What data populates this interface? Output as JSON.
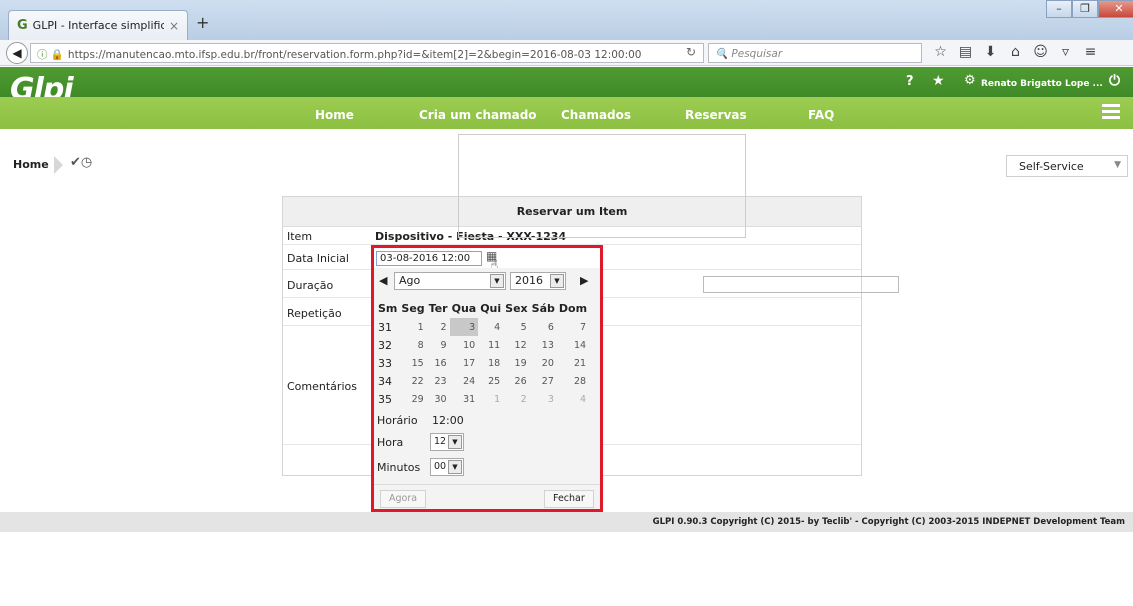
{
  "browser": {
    "tab_title": "GLPI - Interface simplificada",
    "tab_close": "×",
    "new_tab": "+",
    "url": "https://manutencao.mto.ifsp.edu.br/front/reservation.form.php?id=&item[2]=2&begin=2016-08-03 12:00:00",
    "search_placeholder": "Pesquisar"
  },
  "header": {
    "logo": "Glpi",
    "help": "?",
    "user": "Renato Brigatto Lope ...",
    "menu": [
      "Home",
      "Cria um chamado",
      "Chamados",
      "Reservas",
      "FAQ"
    ]
  },
  "breadcrumb": {
    "home": "Home"
  },
  "profile_select": "Self-Service",
  "form": {
    "title": "Reservar um Item",
    "labels": {
      "item": "Item",
      "start": "Data Inicial",
      "duration": "Duração",
      "repeat": "Repetição",
      "comments": "Comentários"
    },
    "item_value": "Dispositivo - Fiesta - XXX-1234",
    "start_value": "03-08-2016 12:00"
  },
  "datepicker": {
    "month": "Ago",
    "year": "2016",
    "headers": [
      "Sm",
      "Seg",
      "Ter",
      "Qua",
      "Qui",
      "Sex",
      "Sáb",
      "Dom"
    ],
    "weeks": [
      [
        "31",
        "1",
        "2",
        "3",
        "4",
        "5",
        "6",
        "7"
      ],
      [
        "32",
        "8",
        "9",
        "10",
        "11",
        "12",
        "13",
        "14"
      ],
      [
        "33",
        "15",
        "16",
        "17",
        "18",
        "19",
        "20",
        "21"
      ],
      [
        "34",
        "22",
        "23",
        "24",
        "25",
        "26",
        "27",
        "28"
      ],
      [
        "35",
        "29",
        "30",
        "31",
        "1",
        "2",
        "3",
        "4"
      ]
    ],
    "time_label": "Horário",
    "time_value": "12:00",
    "hour_label": "Hora",
    "hour_value": "12",
    "minute_label": "Minutos",
    "minute_value": "00",
    "now_button": "Agora",
    "close_button": "Fechar"
  },
  "footer": "GLPI 0.90.3 Copyright (C) 2015- by Teclib' - Copyright (C) 2003-2015 INDEPNET Development Team"
}
